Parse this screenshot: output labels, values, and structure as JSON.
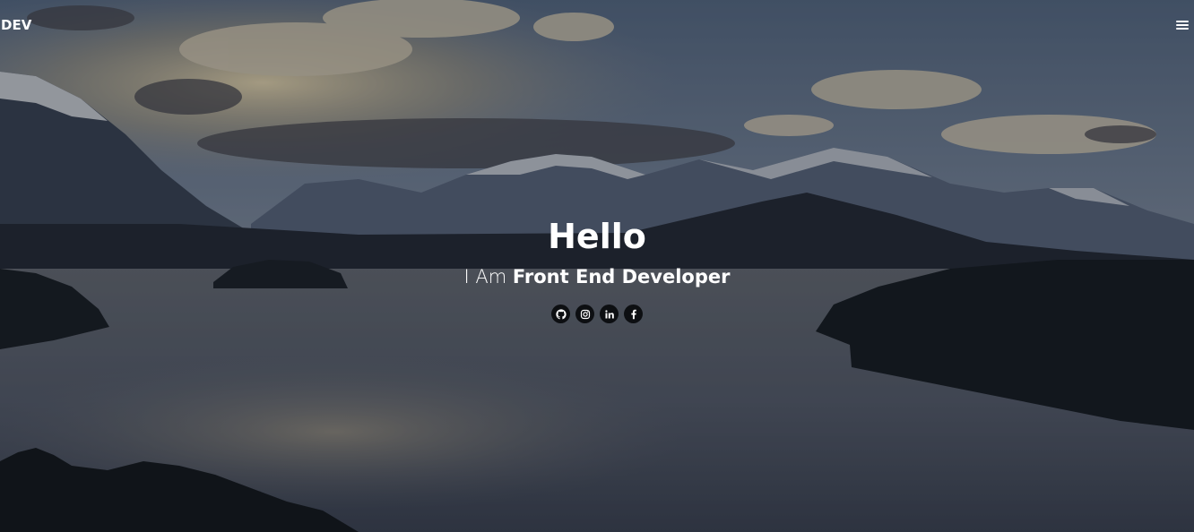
{
  "header": {
    "logo": "DEV",
    "menu_icon": "hamburger-menu-icon"
  },
  "hero": {
    "title": "Hello",
    "subtitle_prefix": "I Am",
    "subtitle_role": "Front End Developer"
  },
  "social_links": [
    {
      "name": "github",
      "icon": "github-icon"
    },
    {
      "name": "instagram",
      "icon": "instagram-icon"
    },
    {
      "name": "linkedin",
      "icon": "linkedin-icon"
    },
    {
      "name": "facebook",
      "icon": "facebook-icon"
    }
  ],
  "colors": {
    "text": "#ffffff",
    "icon_background": "#0d0f12",
    "overlay": "rgba(8,12,20,0.32)"
  }
}
